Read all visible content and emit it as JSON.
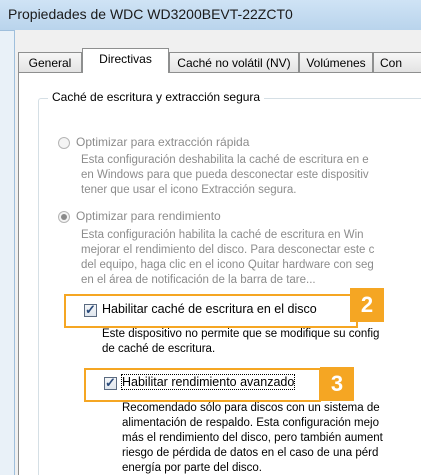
{
  "window": {
    "title": "Propiedades de WDC WD3200BEVT-22ZCT0"
  },
  "tabs": [
    {
      "label": "General",
      "active": false
    },
    {
      "label": "Directivas",
      "active": true
    },
    {
      "label": "Caché no volátil (NV)",
      "active": false
    },
    {
      "label": "Volúmenes",
      "active": false
    },
    {
      "label": "Con",
      "active": false
    }
  ],
  "group": {
    "title": "Caché de escritura y extracción segura"
  },
  "option_quick_removal": {
    "label": "Optimizar para extracción rápida",
    "selected": false,
    "description": [
      "Esta configuración deshabilita la caché de escritura en e",
      "en Windows para que pueda desconectar este dispositiv",
      "tener que usar el icono Extracción segura."
    ]
  },
  "option_performance": {
    "label": "Optimizar para rendimiento",
    "selected": true,
    "description": [
      "Esta configuración habilita la caché  de escritura en Win",
      "mejorar el rendimiento del disco. Para desconectar este c",
      "del equipo, haga clic en el icono Quitar hardware con seg",
      "en el área de notificación de la barra de tare..."
    ]
  },
  "checkbox_write_cache": {
    "label": "Habilitar caché de escritura en el disco",
    "checked": true,
    "badge": "2",
    "description": [
      "Este dispositivo no permite que se modifique su config",
      "de caché de escritura."
    ]
  },
  "checkbox_advanced_performance": {
    "label": "Habilitar rendimiento avanzado",
    "checked": true,
    "badge": "3",
    "description": [
      "Recomendado sólo para discos con un sistema de",
      "alimentación de respaldo. Esta configuración mejo",
      "más el rendimiento del disco, pero también aument",
      "riesgo de pérdida de datos en el caso de una pérd",
      "energía por parte del disco."
    ]
  },
  "colors": {
    "highlight": "#f5a623",
    "title_bar": "#cfe3f5"
  }
}
